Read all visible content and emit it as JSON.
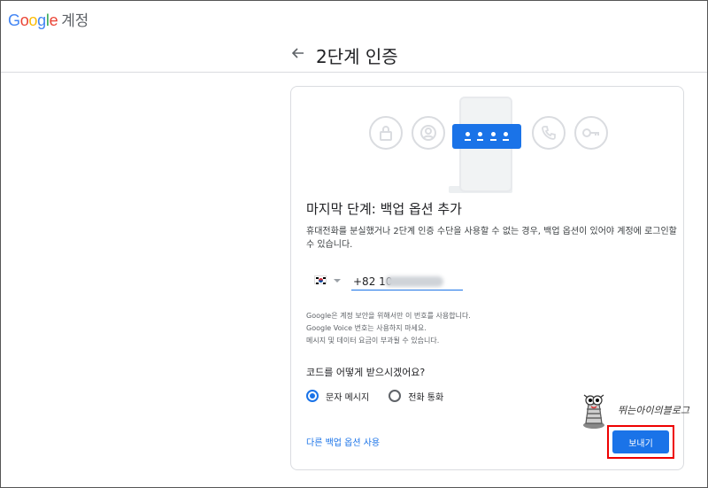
{
  "header": {
    "logo_text": "Google",
    "account_label": "계정"
  },
  "titlebar": {
    "back_icon": "arrow-left-icon",
    "title": "2단계 인증"
  },
  "illustration": {
    "left_icons": [
      "lock-icon",
      "person-icon"
    ],
    "right_icons": [
      "phone-icon",
      "key-icon"
    ],
    "code_digits": 4
  },
  "content": {
    "step_title": "마지막 단계: 백업 옵션 추가",
    "description": "휴대전화를 분실했거나 2단계 인증 수단을 사용할 수 없는 경우, 백업 옵션이 있어야 계정에 로그인할 수 있습니다.",
    "country_flag": "kr-flag-icon",
    "phone_value": "+82 10-",
    "notice_lines": [
      "Google은 계정 보안을 위해서만 이 번호를 사용합니다.",
      "Google Voice 번호는 사용하지 마세요.",
      "메시지 및 데이터 요금이 부과될 수 있습니다."
    ],
    "question": "코드를 어떻게 받으시겠어요?",
    "options": [
      {
        "label": "문자 메시지",
        "selected": true
      },
      {
        "label": "전화 통화",
        "selected": false
      }
    ],
    "other_option_link": "다른 백업 옵션 사용",
    "send_button": "보내기"
  },
  "watermark": {
    "text": "뛰는아이의블로그"
  },
  "colors": {
    "accent": "#1a73e8",
    "highlight_border": "#ee0000"
  }
}
